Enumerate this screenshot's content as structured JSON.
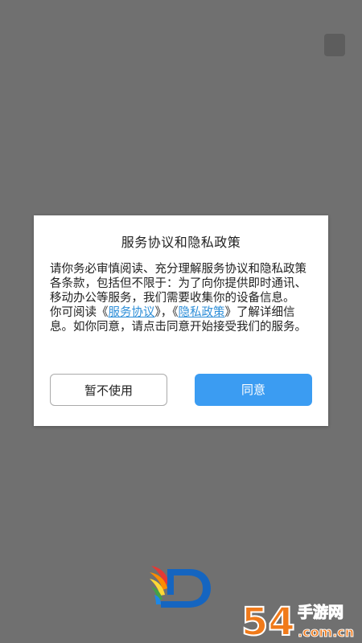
{
  "dialog": {
    "title": "服务协议和隐私政策",
    "body_paragraph_1": "请你务必审慎阅读、充分理解服务协议和隐私政策各条款，包括但不限于：为了向你提供即时通讯、移动办公等服务，我们需要收集你的设备信息。",
    "body_p2_prefix": "你可阅读《",
    "service_agreement_link": "服务协议",
    "body_p2_mid": "》，《",
    "privacy_policy_link": "隐私政策",
    "body_p2_suffix": "》了解详细信息。如你同意，请点击同意开始接受我们的服务。",
    "decline_button_label": "暂不使用",
    "agree_button_label": "同意"
  },
  "watermark": {
    "brand_text": "54",
    "site_cn": "手游网",
    "domain": ".com.cn"
  },
  "colors": {
    "overlay": "#707070",
    "accent": "#3b9cf2",
    "link": "#2f8fd8",
    "watermark_orange": "#f07a1a"
  },
  "icons": {
    "app_logo": "app-logo-icon",
    "corner_square": "square-icon"
  }
}
